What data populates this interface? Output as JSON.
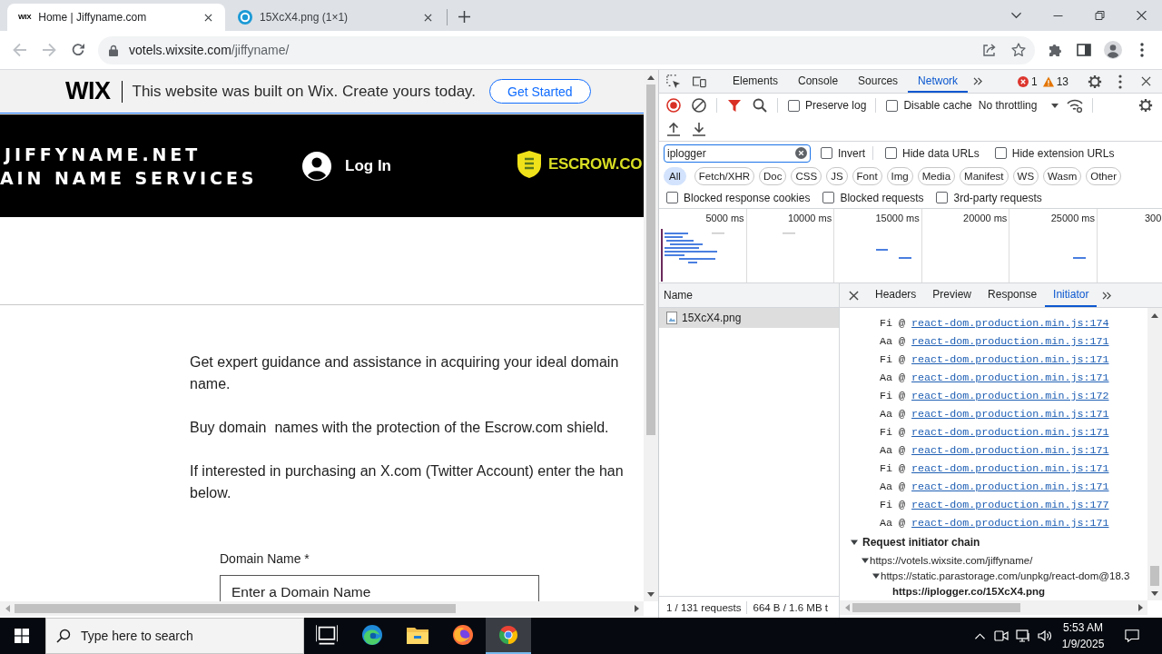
{
  "browser": {
    "tabs": [
      {
        "title": "Home | Jiffyname.com",
        "selected": true,
        "favicon": {
          "kind": "wordmark",
          "text": "WIX"
        }
      },
      {
        "title": "15XcX4.png (1×1)",
        "selected": false,
        "favicon": {
          "kind": "ring"
        }
      }
    ],
    "back": {
      "disabled": true
    },
    "forward": {
      "disabled": true
    },
    "address": {
      "host": "votels.wixsite.com",
      "path": "/jiffyname/"
    }
  },
  "page": {
    "banner": {
      "logo": "WIX",
      "text": "This website was built on Wix. Create yours today.",
      "button": "Get Started"
    },
    "header": {
      "title_lines": [
        "JIFFYNAME.NET",
        "AIN NAME SERVICES"
      ],
      "login": "Log In",
      "partner_logo": "ESCROW.CO"
    },
    "paragraphs": [
      "Get expert guidance and assistance in acquiring your ideal domain name.",
      "Buy domain  names with the protection of the Escrow.com shield.",
      "If interested in purchasing an X.com (Twitter Account) enter the han below."
    ],
    "form": {
      "label": "Domain Name *",
      "placeholder": "Enter a Domain Name"
    }
  },
  "devtools": {
    "tabs": [
      {
        "label": "Elements",
        "selected": false
      },
      {
        "label": "Console",
        "selected": false
      },
      {
        "label": "Sources",
        "selected": false
      },
      {
        "label": "Network",
        "selected": true
      }
    ],
    "errors": "1",
    "warnings": "13",
    "recording": true,
    "options": [
      {
        "label": "Preserve log",
        "checked": false
      },
      {
        "label": "Disable cache",
        "checked": false
      }
    ],
    "throttling": "No throttling",
    "filter": {
      "value": "iplogger"
    },
    "filter_options": [
      {
        "label": "Invert",
        "checked": false
      },
      {
        "label": "Hide data URLs",
        "checked": false
      },
      {
        "label": "Hide extension URLs",
        "checked": false
      }
    ],
    "types": [
      {
        "label": "All",
        "selected": true
      },
      {
        "label": "Fetch/XHR",
        "selected": false
      },
      {
        "label": "Doc",
        "selected": false
      },
      {
        "label": "CSS",
        "selected": false
      },
      {
        "label": "JS",
        "selected": false
      },
      {
        "label": "Font",
        "selected": false
      },
      {
        "label": "Img",
        "selected": false
      },
      {
        "label": "Media",
        "selected": false
      },
      {
        "label": "Manifest",
        "selected": false
      },
      {
        "label": "WS",
        "selected": false
      },
      {
        "label": "Wasm",
        "selected": false
      },
      {
        "label": "Other",
        "selected": false
      }
    ],
    "more_options": [
      {
        "label": "Blocked response cookies",
        "checked": false
      },
      {
        "label": "Blocked requests",
        "checked": false
      },
      {
        "label": "3rd-party requests",
        "checked": false
      }
    ],
    "overview_ticks": [
      "5000 ms",
      "10000 ms",
      "15000 ms",
      "20000 ms",
      "25000 ms",
      "300"
    ],
    "requests": {
      "column": "Name",
      "rows": [
        {
          "name": "15XcX4.png",
          "selected": true
        }
      ]
    },
    "detail_tabs": [
      {
        "label": "Headers",
        "selected": false
      },
      {
        "label": "Preview",
        "selected": false
      },
      {
        "label": "Response",
        "selected": false
      },
      {
        "label": "Initiator",
        "selected": true
      }
    ],
    "call_stack": [
      {
        "caller": "Fi @",
        "location": "react-dom.production.min.js:174"
      },
      {
        "caller": "Aa @",
        "location": "react-dom.production.min.js:171"
      },
      {
        "caller": "Fi @",
        "location": "react-dom.production.min.js:171"
      },
      {
        "caller": "Aa @",
        "location": "react-dom.production.min.js:171"
      },
      {
        "caller": "Fi @",
        "location": "react-dom.production.min.js:172"
      },
      {
        "caller": "Aa @",
        "location": "react-dom.production.min.js:171"
      },
      {
        "caller": "Fi @",
        "location": "react-dom.production.min.js:171"
      },
      {
        "caller": "Aa @",
        "location": "react-dom.production.min.js:171"
      },
      {
        "caller": "Fi @",
        "location": "react-dom.production.min.js:171"
      },
      {
        "caller": "Aa @",
        "location": "react-dom.production.min.js:171"
      },
      {
        "caller": "Fi @",
        "location": "react-dom.production.min.js:177"
      },
      {
        "caller": "Aa @",
        "location": "react-dom.production.min.js:171"
      }
    ],
    "chain": {
      "title": "Request initiator chain",
      "expanded": true,
      "nodes": [
        {
          "url": "https://votels.wixsite.com/jiffyname/",
          "expanded": true,
          "current": false,
          "children": [
            {
              "url": "https://static.parastorage.com/unpkg/react-dom@18.3",
              "expanded": true,
              "current": false,
              "children": [
                {
                  "url": "https://iplogger.co/15XcX4.png",
                  "current": true
                }
              ]
            }
          ]
        }
      ]
    },
    "status": [
      "1 / 131 requests",
      "664 B / 1.6 MB t"
    ]
  },
  "taskbar": {
    "search_placeholder": "Type here to search",
    "apps": [
      {
        "kind": "task-view",
        "active": false
      },
      {
        "kind": "edge",
        "active": false
      },
      {
        "kind": "explorer",
        "active": false
      },
      {
        "kind": "firefox",
        "active": false
      },
      {
        "kind": "chrome",
        "active": true
      }
    ],
    "time": "5:53 AM",
    "date": "1/9/2025"
  }
}
